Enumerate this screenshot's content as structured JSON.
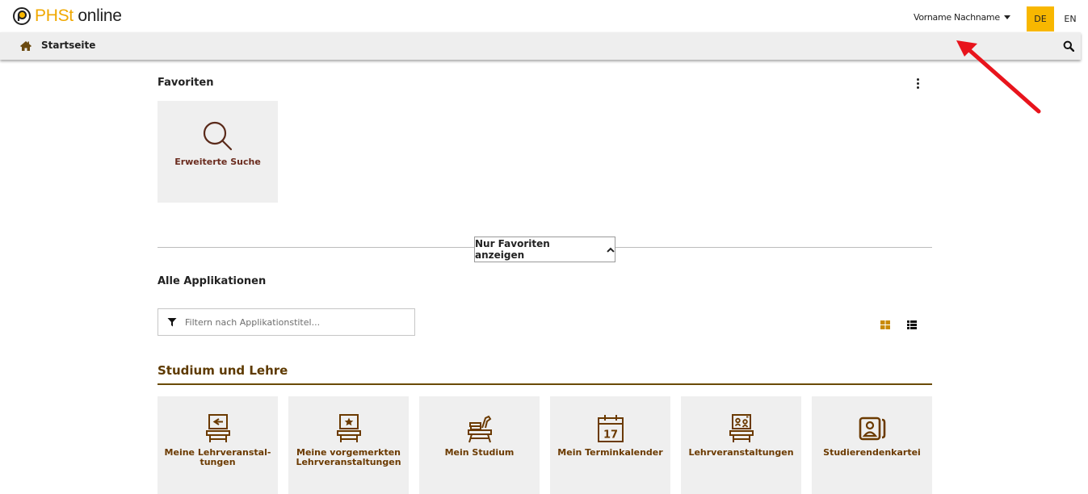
{
  "header": {
    "logo_brand": "PHSt",
    "logo_rest": " online",
    "user_name": "Vorname Nachname",
    "lang_active": "DE",
    "lang_other": "EN"
  },
  "nav": {
    "title": "Startseite"
  },
  "favorites": {
    "title": "Favoriten",
    "items": [
      {
        "label": "Erweiterte Suche",
        "icon": "magnifier-icon"
      }
    ],
    "toggle_label": "Nur Favoriten anzeigen"
  },
  "applications": {
    "title": "Alle Applikationen",
    "filter_placeholder": "Filtern nach Applikationstitel...",
    "category": "Studium und Lehre",
    "items": [
      {
        "label": "Meine Lehrveranstal-\ntungen",
        "icon": "lecture-desk-arrow-icon"
      },
      {
        "label": "Meine vorgemerkten\nLehrveranstaltungen",
        "icon": "lecture-desk-star-icon"
      },
      {
        "label": "Mein Studium",
        "icon": "study-desk-icon"
      },
      {
        "label": "Mein Terminkalender",
        "icon": "calendar-icon"
      },
      {
        "label": "Lehrveranstaltungen",
        "icon": "lecture-desk-people-icon"
      },
      {
        "label": "Studierendenkartei",
        "icon": "student-card-icon"
      }
    ]
  },
  "colors": {
    "accent": "#f8b700",
    "brand_brown": "#6b3a00",
    "tile_bg": "#efefef",
    "annotation_arrow": "#e8141c"
  },
  "calendar_day": "17"
}
